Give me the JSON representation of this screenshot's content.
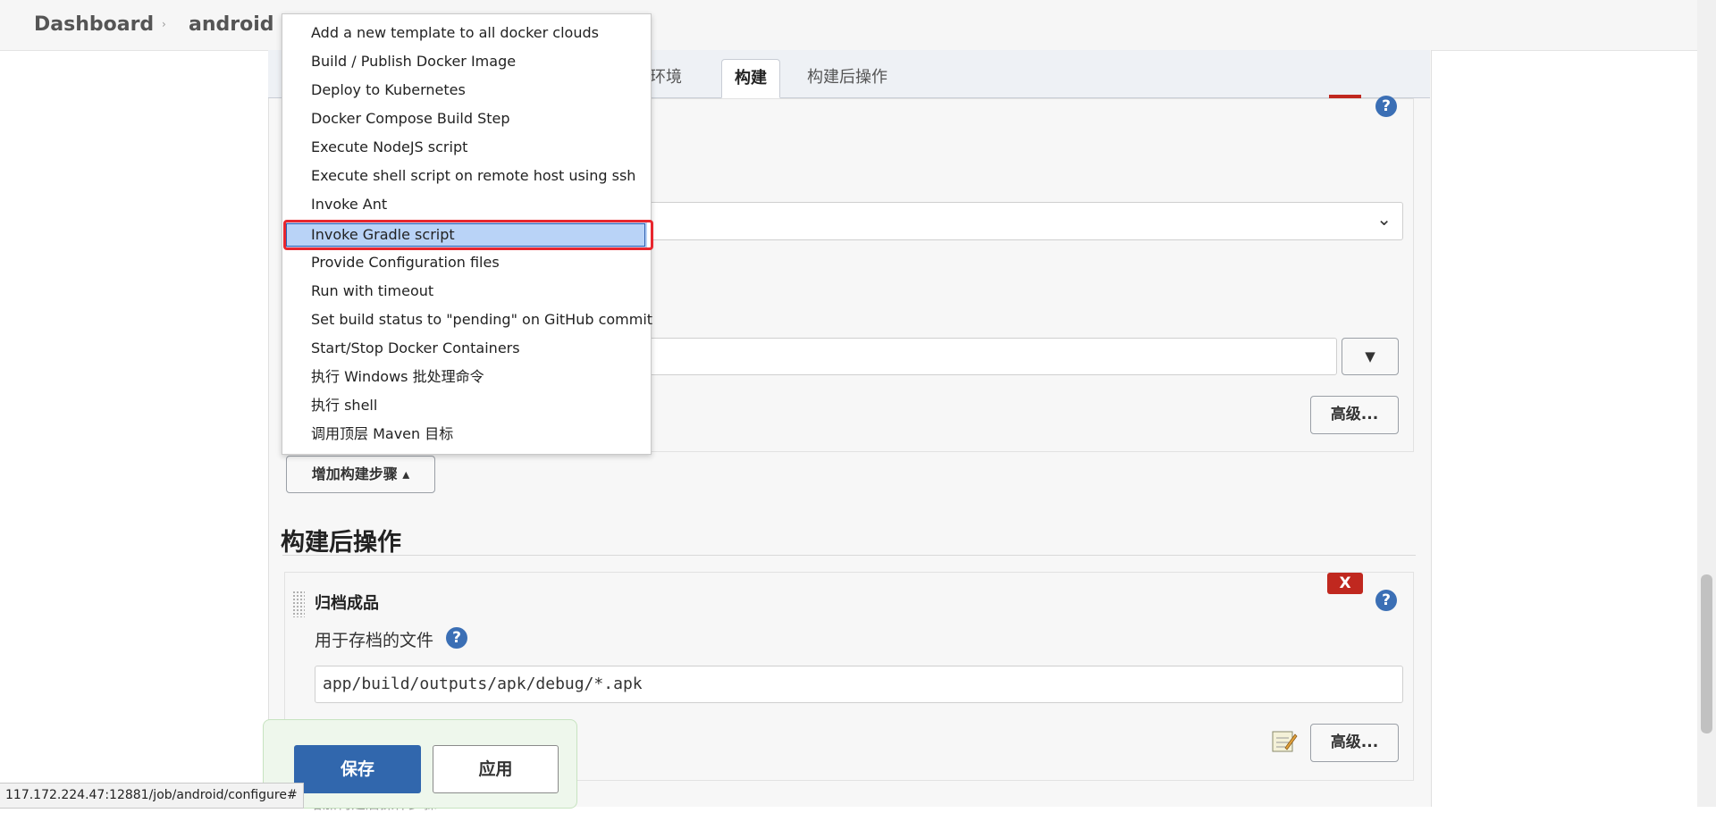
{
  "breadcrumb": {
    "dashboard": "Dashboard",
    "project": "android",
    "separator": "›"
  },
  "tabs": [
    {
      "label": "建环境",
      "active": false
    },
    {
      "label": "构建",
      "active": true
    },
    {
      "label": "构建后操作",
      "active": false
    }
  ],
  "build_section": {
    "advanced_button": "高级...",
    "dropdown_arrow": "▼",
    "select_chevron": "⌄",
    "add_step_button": "增加构建步骤 ▴"
  },
  "post_build": {
    "heading": "构建后操作",
    "archive_title": "归档成品",
    "files_label": "用于存档的文件",
    "files_value": "app/build/outputs/apk/debug/*.apk",
    "advanced_button": "高级...",
    "delete_label": "X",
    "add_post_step_button": "增加构建后操作步骤 ▾"
  },
  "help_glyph": "?",
  "footer": {
    "save": "保存",
    "apply": "应用"
  },
  "status_url": "117.172.224.47:12881/job/android/configure#",
  "menu": {
    "items": [
      "Add a new template to all docker clouds",
      "Build / Publish Docker Image",
      "Deploy to Kubernetes",
      "Docker Compose Build Step",
      "Execute NodeJS script",
      "Execute shell script on remote host using ssh",
      "Invoke Ant",
      "Invoke Gradle script",
      "Provide Configuration files",
      "Run with timeout",
      "Set build status to \"pending\" on GitHub commit",
      "Start/Stop Docker Containers",
      "执行 Windows 批处理命令",
      "执行 shell",
      "调用顶层 Maven 目标"
    ],
    "selected": "Invoke Gradle script"
  },
  "colors": {
    "primary": "#3167ad",
    "danger": "#c0281f",
    "highlight": "#e8262e",
    "menu_selected": "#b9d3f7"
  },
  "icons": [
    "help-icon",
    "chevron-down-icon",
    "drag-handle-icon",
    "notepad-icon",
    "caret-up-icon"
  ]
}
